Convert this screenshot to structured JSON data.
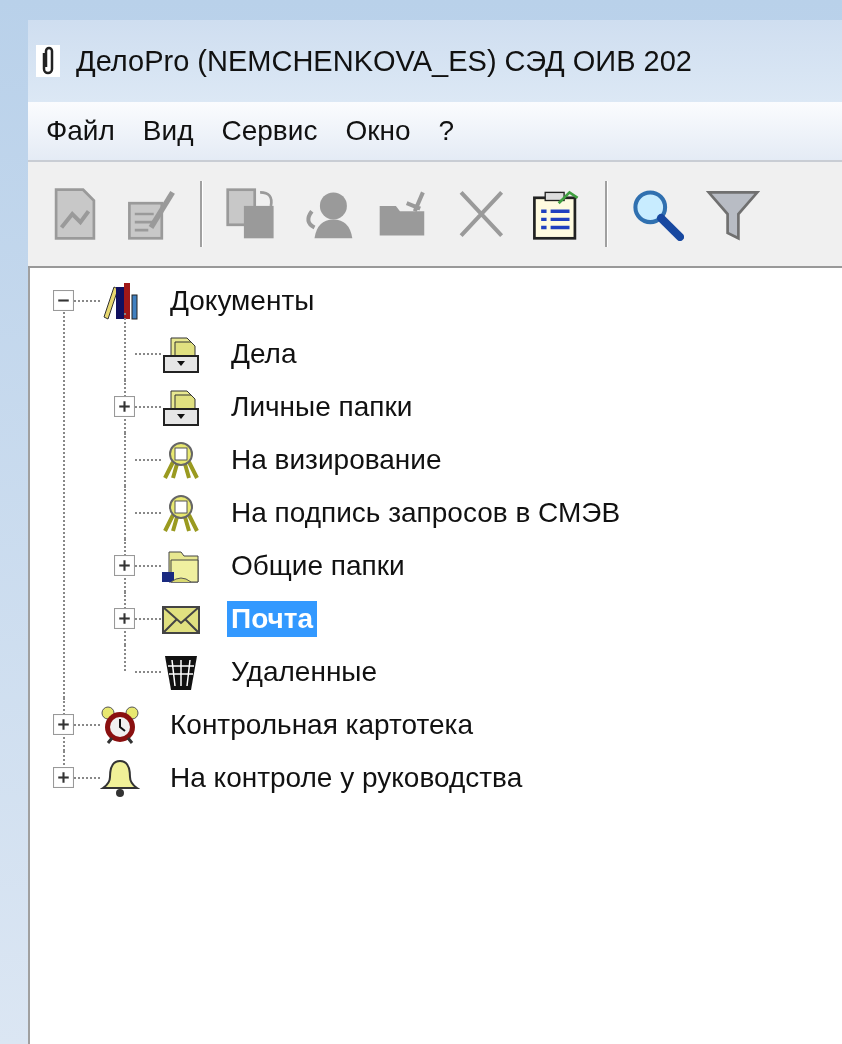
{
  "window": {
    "title": "ДелоPro (NEMCHENKOVA_ES) СЭД ОИВ 202"
  },
  "menu": [
    "Файл",
    "Вид",
    "Сервис",
    "Окно",
    "?"
  ],
  "toolbar": [
    {
      "kind": "new-document",
      "disabled": true
    },
    {
      "kind": "edit-document",
      "disabled": true
    },
    {
      "kind": "separator"
    },
    {
      "kind": "copy-document",
      "disabled": true
    },
    {
      "kind": "person",
      "disabled": true
    },
    {
      "kind": "folder-hand",
      "disabled": true
    },
    {
      "kind": "delete",
      "disabled": true
    },
    {
      "kind": "properties",
      "disabled": false
    },
    {
      "kind": "separator"
    },
    {
      "kind": "search",
      "disabled": false
    },
    {
      "kind": "filter",
      "disabled": false
    }
  ],
  "tree": [
    {
      "label": "Документы",
      "kind": "books",
      "expandable": true,
      "expanded": true,
      "selected": false,
      "children": [
        {
          "label": "Дела",
          "kind": "cabinet",
          "expandable": false,
          "selected": false
        },
        {
          "label": "Личные папки",
          "kind": "cabinet",
          "expandable": true,
          "expanded": false,
          "selected": false
        },
        {
          "label": "На визирование",
          "kind": "award",
          "expandable": false,
          "selected": false
        },
        {
          "label": "На подпись запросов в СМЭВ",
          "kind": "award",
          "expandable": false,
          "selected": false
        },
        {
          "label": "Общие папки",
          "kind": "shared-folder",
          "expandable": true,
          "expanded": false,
          "selected": false
        },
        {
          "label": "Почта",
          "kind": "envelope",
          "expandable": true,
          "expanded": false,
          "selected": true
        },
        {
          "label": "Удаленные",
          "kind": "basket",
          "expandable": false,
          "selected": false
        }
      ]
    },
    {
      "label": "Контрольная картотека",
      "kind": "alarm-clock",
      "expandable": true,
      "expanded": false,
      "selected": false
    },
    {
      "label": "На контроле у руководства",
      "kind": "bell",
      "expandable": true,
      "expanded": false,
      "selected": false
    }
  ]
}
